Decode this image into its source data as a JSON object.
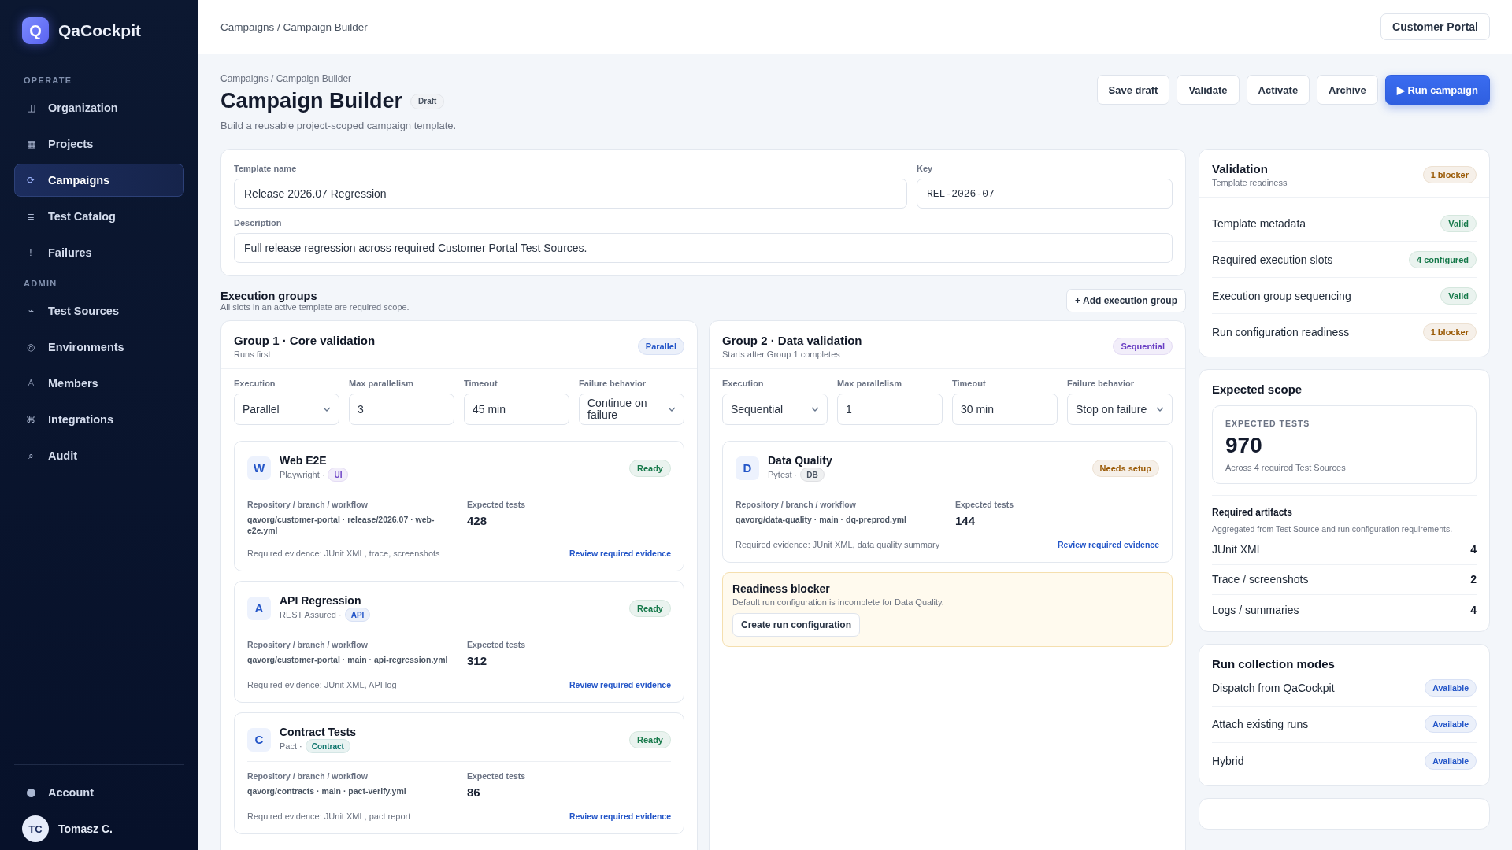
{
  "sidebar": {
    "brand": {
      "logo": "Q",
      "name": "QaCockpit"
    },
    "sections": [
      {
        "heading": "OPERATE",
        "items": [
          {
            "icon": "◫",
            "label": "Organization",
            "selected": false
          },
          {
            "icon": "▦",
            "label": "Projects",
            "selected": false
          },
          {
            "icon": "⟳",
            "label": "Campaigns",
            "selected": true
          },
          {
            "icon": "≣",
            "label": "Test Catalog",
            "selected": false
          },
          {
            "icon": "!",
            "label": "Failures",
            "selected": false
          }
        ]
      },
      {
        "heading": "ADMIN",
        "items": [
          {
            "icon": "⌁",
            "label": "Test Sources",
            "selected": false
          },
          {
            "icon": "◎",
            "label": "Environments",
            "selected": false
          },
          {
            "icon": "♙",
            "label": "Members",
            "selected": false
          },
          {
            "icon": "⌘",
            "label": "Integrations",
            "selected": false
          },
          {
            "icon": "⌕",
            "label": "Audit",
            "selected": false
          }
        ]
      }
    ],
    "account": "Account",
    "user": {
      "initials": "TC",
      "name": "Tomasz C."
    }
  },
  "topbar": {
    "breadcrumb": "Campaigns / Campaign Builder",
    "project_button": "Customer Portal"
  },
  "header": {
    "breadcrumb": "Campaigns / Campaign Builder",
    "title": "Campaign Builder",
    "status": "Draft",
    "subtitle": "Build a reusable project-scoped campaign template.",
    "actions": [
      {
        "label": "Save draft",
        "kind": "secondary"
      },
      {
        "label": "Validate",
        "kind": "secondary"
      },
      {
        "label": "Activate",
        "kind": "secondary"
      },
      {
        "label": "Archive",
        "kind": "secondary"
      },
      {
        "label": "▶ Run campaign",
        "kind": "primary"
      }
    ]
  },
  "template": {
    "name": {
      "label": "Template name",
      "value": "Release 2026.07 Regression"
    },
    "key": {
      "label": "Key",
      "value": "REL-2026-07"
    },
    "description": {
      "label": "Description",
      "value": "Full release regression across required Customer Portal Test Sources."
    }
  },
  "execution_groups": {
    "title": "Execution groups",
    "subtitle": "All slots in an active template are required scope.",
    "add_button": "+ Add execution group",
    "groups": [
      {
        "title": "Group 1 · Core validation",
        "subtitle": "Runs first",
        "mode": {
          "label": "Parallel",
          "color": "#2456c8"
        },
        "settings": [
          {
            "label": "Execution",
            "value": "Parallel",
            "kind": "select"
          },
          {
            "label": "Max parallelism",
            "value": "3",
            "kind": "input"
          },
          {
            "label": "Timeout",
            "value": "45 min",
            "kind": "input"
          },
          {
            "label": "Failure behavior",
            "value": "Continue on failure",
            "kind": "select"
          }
        ],
        "sources": [
          {
            "initial": "W",
            "name": "Web E2E",
            "framework": "Playwright ·",
            "tag": {
              "label": "UI",
              "color": "#6a3fc4"
            },
            "status": {
              "label": "Ready",
              "color": "#16794a"
            },
            "repo_label": "Repository / branch / workflow",
            "repo": "qavorg/customer-portal · release/2026.07 · web-e2e.yml",
            "tests_label": "Expected tests",
            "tests": "428",
            "evidence": "Required evidence: JUnit XML, trace, screenshots",
            "link": "Review required evidence"
          },
          {
            "initial": "A",
            "name": "API Regression",
            "framework": "REST Assured ·",
            "tag": {
              "label": "API",
              "color": "#2456c8"
            },
            "status": {
              "label": "Ready",
              "color": "#16794a"
            },
            "repo_label": "Repository / branch / workflow",
            "repo": "qavorg/customer-portal · main · api-regression.yml",
            "tests_label": "Expected tests",
            "tests": "312",
            "evidence": "Required evidence: JUnit XML, API log",
            "link": "Review required evidence"
          },
          {
            "initial": "C",
            "name": "Contract Tests",
            "framework": "Pact ·",
            "tag": {
              "label": "Contract",
              "color": "#0f766e"
            },
            "status": {
              "label": "Ready",
              "color": "#16794a"
            },
            "repo_label": "Repository / branch / workflow",
            "repo": "qavorg/contracts · main · pact-verify.yml",
            "tests_label": "Expected tests",
            "tests": "86",
            "evidence": "Required evidence: JUnit XML, pact report",
            "link": "Review required evidence"
          }
        ]
      },
      {
        "title": "Group 2 · Data validation",
        "subtitle": "Starts after Group 1 completes",
        "mode": {
          "label": "Sequential",
          "color": "#6a3fc4"
        },
        "settings": [
          {
            "label": "Execution",
            "value": "Sequential",
            "kind": "select"
          },
          {
            "label": "Max parallelism",
            "value": "1",
            "kind": "input"
          },
          {
            "label": "Timeout",
            "value": "30 min",
            "kind": "input"
          },
          {
            "label": "Failure behavior",
            "value": "Stop on failure",
            "kind": "select"
          }
        ],
        "sources": [
          {
            "initial": "D",
            "name": "Data Quality",
            "framework": "Pytest ·",
            "tag": {
              "label": "DB",
              "color": "#4b5563"
            },
            "status": {
              "label": "Needs setup",
              "color": "#9a5a06"
            },
            "repo_label": "Repository / branch / workflow",
            "repo": "qavorg/data-quality · main · dq-preprod.yml",
            "tests_label": "Expected tests",
            "tests": "144",
            "evidence": "Required evidence: JUnit XML, data quality summary",
            "link": "Review required evidence"
          }
        ],
        "blocker": {
          "title": "Readiness blocker",
          "text": "Default run configuration is incomplete for Data Quality.",
          "button": "Create run configuration"
        }
      }
    ]
  },
  "validation": {
    "title": "Validation",
    "subtitle": "Template readiness",
    "badge": {
      "label": "1 blocker",
      "color": "#9a5a06"
    },
    "items": [
      {
        "label": "Template metadata",
        "badge": {
          "label": "Valid",
          "color": "#16794a"
        }
      },
      {
        "label": "Required execution slots",
        "badge": {
          "label": "4 configured",
          "color": "#16794a"
        }
      },
      {
        "label": "Execution group sequencing",
        "badge": {
          "label": "Valid",
          "color": "#16794a"
        }
      },
      {
        "label": "Run configuration readiness",
        "badge": {
          "label": "1 blocker",
          "color": "#9a5a06"
        }
      }
    ]
  },
  "expected_scope": {
    "title": "Expected scope",
    "stat_label": "EXPECTED TESTS",
    "stat_value": "970",
    "stat_note": "Across 4 required Test Sources",
    "artifacts_title": "Required artifacts",
    "artifacts_note": "Aggregated from Test Source and run configuration requirements.",
    "artifacts": [
      {
        "label": "JUnit XML",
        "count": "4"
      },
      {
        "label": "Trace / screenshots",
        "count": "2"
      },
      {
        "label": "Logs / summaries",
        "count": "4"
      }
    ]
  },
  "run_modes": {
    "title": "Run collection modes",
    "items": [
      {
        "label": "Dispatch from QaCockpit",
        "badge": {
          "label": "Available",
          "color": "#2456c8"
        }
      },
      {
        "label": "Attach existing runs",
        "badge": {
          "label": "Available",
          "color": "#2456c8"
        }
      },
      {
        "label": "Hybrid",
        "badge": {
          "label": "Available",
          "color": "#2456c8"
        }
      }
    ]
  }
}
